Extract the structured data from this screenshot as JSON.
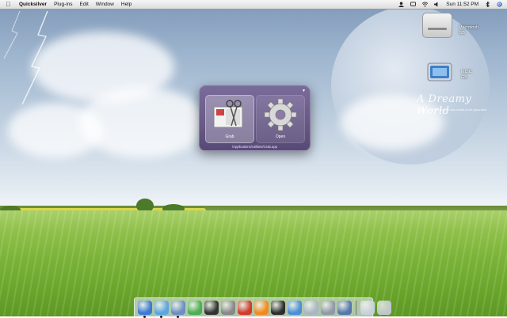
{
  "menubar": {
    "apple_icon": "apple-icon",
    "app_name": "Quicksilver",
    "menus": [
      "Plug-ins",
      "Edit",
      "Window",
      "Help"
    ],
    "clock": "Sun 11:52 PM",
    "status_icons": [
      "user-icon",
      "messages-icon",
      "wifi-icon",
      "volume-icon",
      "spotlight-icon",
      "bluetooth-icon"
    ]
  },
  "desktop": {
    "icons": [
      {
        "name": "hard-disk-icon",
        "label_line1": "Macintosh",
        "label_line2": "GB"
      },
      {
        "name": "external-disk-icon",
        "label_line1": "MISC",
        "label_line2": "GB"
      }
    ],
    "wallpaper_text": "A Dreamy World",
    "wallpaper_subtext": "If you can't dream you are meant to be grounded"
  },
  "quicksilver": {
    "direct_object_label": "Grab",
    "action_label": "Open",
    "path_text": "/Applications/Utilities/Grab.app",
    "direct_object_icon": "grab-scissors-icon",
    "action_icon": "gear-icon"
  },
  "dock": {
    "items": [
      {
        "name": "finder-icon",
        "color": "#3a7bd5",
        "running": true
      },
      {
        "name": "safari-icon",
        "color": "#5aa6e0",
        "running": true
      },
      {
        "name": "mail-icon",
        "color": "#6b8fc2",
        "running": true
      },
      {
        "name": "adium-icon",
        "color": "#4caf50",
        "running": false
      },
      {
        "name": "dashboard-icon",
        "color": "#333333",
        "running": false
      },
      {
        "name": "ichat-icon",
        "color": "#888888",
        "running": false
      },
      {
        "name": "tomato-icon",
        "color": "#d23a2a",
        "running": false
      },
      {
        "name": "vlc-icon",
        "color": "#f28a1b",
        "running": false
      },
      {
        "name": "imovie-icon",
        "color": "#2d2d2d",
        "running": false
      },
      {
        "name": "itunes-icon",
        "color": "#4a8fd8",
        "running": false
      },
      {
        "name": "ipod-icon",
        "color": "#aab6c4",
        "running": false
      },
      {
        "name": "system-preferences-icon",
        "color": "#9099a6",
        "running": false
      },
      {
        "name": "preview-icon",
        "color": "#5577aa",
        "running": false
      }
    ],
    "trailing_items": [
      {
        "name": "documents-stack-icon",
        "color": "#c8d0da"
      },
      {
        "name": "trash-icon",
        "color": "#c0c6cc"
      }
    ]
  }
}
